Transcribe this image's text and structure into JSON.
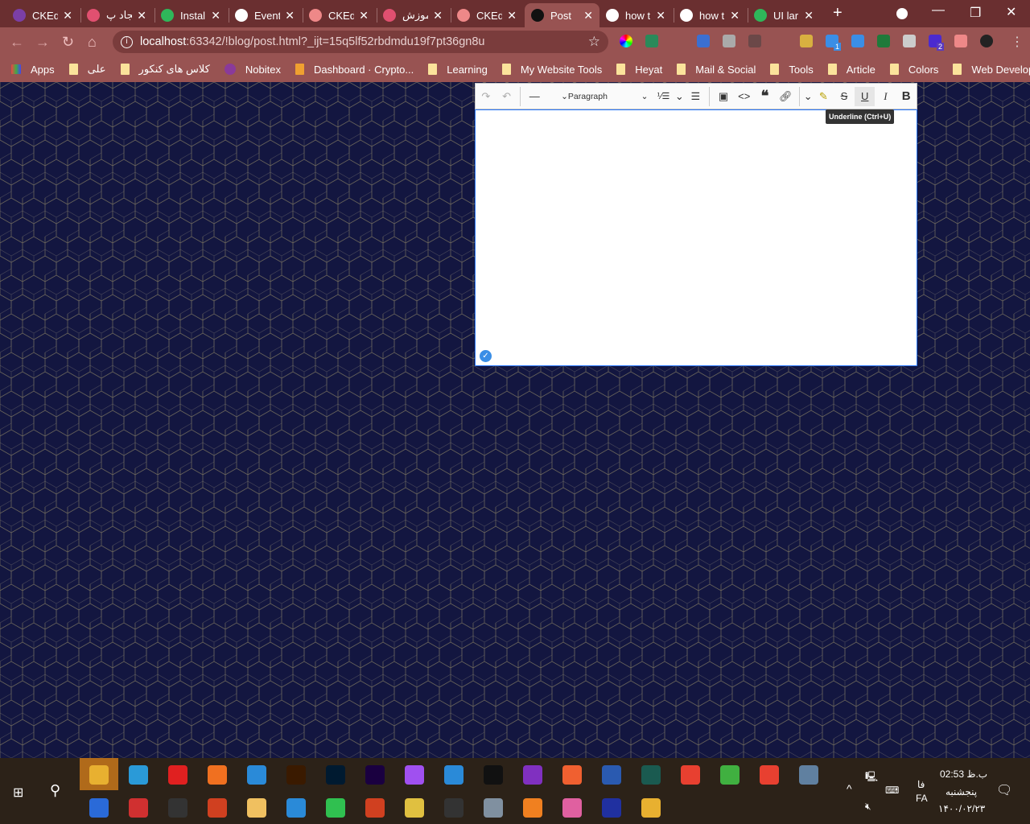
{
  "browser": {
    "tabs": [
      {
        "title": "CKEd",
        "icon": "ckeditor-icon",
        "color": "#7b3fa6"
      },
      {
        "title": "ایجاد پ",
        "icon": "rocket-icon",
        "color": "#e05070"
      },
      {
        "title": "Instal",
        "icon": "node-icon",
        "color": "#2fb75a"
      },
      {
        "title": "Event",
        "icon": "pen-icon",
        "color": "#ffffff"
      },
      {
        "title": "CKEd",
        "icon": "globe-icon",
        "color": "#e88"
      },
      {
        "title": "آموزش",
        "icon": "rocket-icon",
        "color": "#e05070"
      },
      {
        "title": "CKEd",
        "icon": "globe-icon",
        "color": "#e88"
      },
      {
        "title": "Post",
        "icon": "webstorm-icon",
        "color": "#111",
        "active": true
      },
      {
        "title": "how t",
        "icon": "google-icon",
        "color": "#fff"
      },
      {
        "title": "how t",
        "icon": "google-icon",
        "color": "#fff"
      },
      {
        "title": "UI lar",
        "icon": "node-icon",
        "color": "#2fb75a"
      }
    ],
    "new_tab": "+",
    "url_host": "localhost",
    "url_rest": ":63342/!blog/post.html?_ijt=15q5lf52rbdmdu19f7pt36gn8u",
    "extension_badges": [
      "1",
      "2"
    ],
    "bookmarks": [
      "Apps",
      "علی",
      "کلاس های کنکور",
      "Nobitex",
      "Dashboard · Crypto...",
      "Learning",
      "My Website Tools",
      "Heyat",
      "Mail & Social",
      "Tools",
      "Article",
      "Colors",
      "Web Develope"
    ],
    "more": "»"
  },
  "editor": {
    "heading_select": "Paragraph",
    "tooltip": "Underline (Ctrl+U)",
    "buttons": [
      "redo",
      "undo",
      "horizontal-line",
      "heading",
      "numbered-list",
      "bulleted-list",
      "image",
      "code",
      "block-quote",
      "link",
      "highlight",
      "strikethrough",
      "underline",
      "italic",
      "bold"
    ]
  },
  "taskbar": {
    "time": "02:53 ب.ظ",
    "day": "پنجشنبه",
    "date": "۱۴۰۰/۰۲/۲۳",
    "lang_fa": "فا",
    "lang": "FA"
  }
}
